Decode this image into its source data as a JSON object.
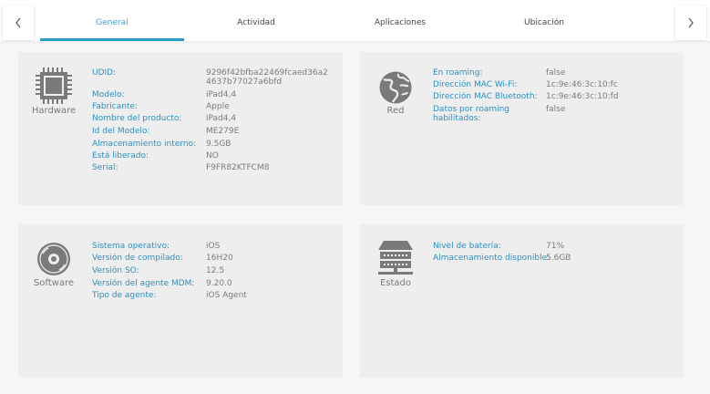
{
  "tabs": [
    "General",
    "Actividad",
    "Aplicaciones",
    "Ubicación"
  ],
  "nav": {
    "prev_icon": "chevron-left-icon",
    "next_icon": "chevron-right-icon"
  },
  "hardware": {
    "title": "Hardware",
    "rows": [
      {
        "label": "UDID:",
        "value": "9296f42bfba22469fcaed36a2",
        "value2": "4637b77027a6bfd"
      },
      {
        "label": "Modelo:",
        "value": "iPad4,4"
      },
      {
        "label": "Fabricante:",
        "value": "Apple"
      },
      {
        "label": "Nombre del producto:",
        "value": "iPad4,4"
      },
      {
        "label": "Id del Modelo:",
        "value": "ME279E"
      },
      {
        "label": "Almacenamiento interno:",
        "value": "9.5GB"
      },
      {
        "label": "Está liberado:",
        "value": "NO"
      },
      {
        "label": "Serial:",
        "value": "F9FR82KTFCM8"
      }
    ]
  },
  "network": {
    "title": "Red",
    "rows": [
      {
        "label": "En roaming:",
        "value": "false"
      },
      {
        "label": "Dirección MAC Wi-Fi:",
        "value": "1c:9e:46:3c:10:fc"
      },
      {
        "label": "Dirección MAC Bluetooth:",
        "value": "1c:9e:46:3c:10:fd"
      },
      {
        "label": "Datos por roaming",
        "label2": "habilitados:",
        "value": "false"
      }
    ]
  },
  "software": {
    "title": "Software",
    "rows": [
      {
        "label": "Sistema operativo:",
        "value": "iOS"
      },
      {
        "label": "Versión de compilado:",
        "value": "16H20"
      },
      {
        "label": "Versión SO:",
        "value": "12.5"
      },
      {
        "label": "Versión del agente MDM:",
        "value": "9.20.0"
      },
      {
        "label": "Tipo de agente:",
        "value": "iOS Agent"
      }
    ]
  },
  "status": {
    "title": "Estado",
    "rows": [
      {
        "label": "Nivel de batería:",
        "value": "71%"
      },
      {
        "label": "Almacenamiento disponible:",
        "value": "5.6GB"
      }
    ]
  }
}
